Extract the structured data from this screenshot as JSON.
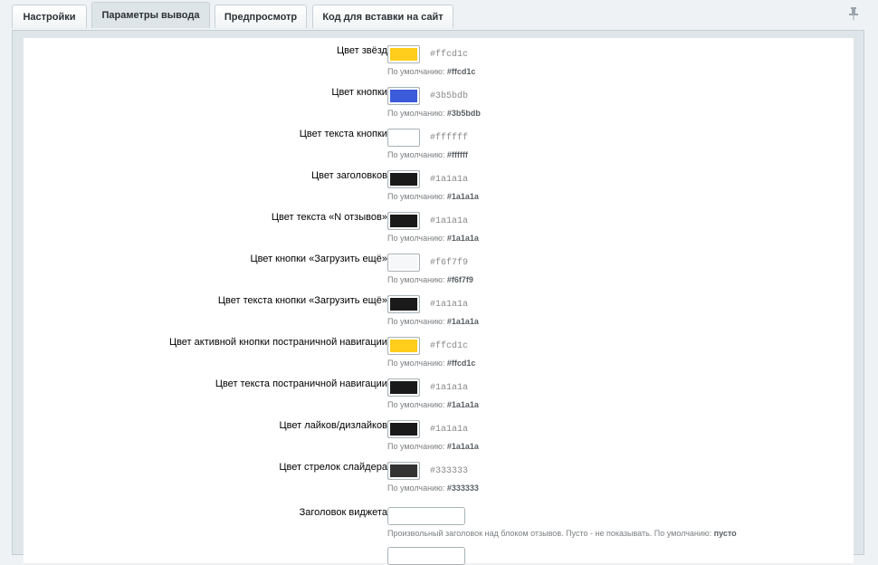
{
  "tabs": [
    {
      "label": "Настройки"
    },
    {
      "label": "Параметры вывода"
    },
    {
      "label": "Предпросмотр"
    },
    {
      "label": "Код для вставки на сайт"
    }
  ],
  "default_prefix": "По умолчанию:",
  "color_rows": [
    {
      "label": "Цвет звёзд:",
      "value": "#ffcd1c",
      "default": "#ffcd1c",
      "color": "#ffcd1c"
    },
    {
      "label": "Цвет кнопки:",
      "value": "#3b5bdb",
      "default": "#3b5bdb",
      "color": "#3b5bdb"
    },
    {
      "label": "Цвет текста кнопки:",
      "value": "#ffffff",
      "default": "#ffffff",
      "color": "#ffffff"
    },
    {
      "label": "Цвет заголовков:",
      "value": "#1a1a1a",
      "default": "#1a1a1a",
      "color": "#1a1a1a"
    },
    {
      "label": "Цвет текста «N отзывов»:",
      "value": "#1a1a1a",
      "default": "#1a1a1a",
      "color": "#1a1a1a"
    },
    {
      "label": "Цвет кнопки «Загрузить ещё»:",
      "value": "#f6f7f9",
      "default": "#f6f7f9",
      "color": "#f6f7f9"
    },
    {
      "label": "Цвет текста кнопки «Загрузить ещё»:",
      "value": "#1a1a1a",
      "default": "#1a1a1a",
      "color": "#1a1a1a"
    },
    {
      "label": "Цвет активной кнопки постраничной навигации:",
      "value": "#ffcd1c",
      "default": "#ffcd1c",
      "color": "#ffcd1c"
    },
    {
      "label": "Цвет текста постраничной навигации:",
      "value": "#1a1a1a",
      "default": "#1a1a1a",
      "color": "#1a1a1a"
    },
    {
      "label": "Цвет лайков/дизлайков:",
      "value": "#1a1a1a",
      "default": "#1a1a1a",
      "color": "#1a1a1a"
    },
    {
      "label": "Цвет стрелок слайдера:",
      "value": "#333333",
      "default": "#333333",
      "color": "#333333"
    }
  ],
  "widget_title": {
    "label": "Заголовок виджета:",
    "value": "",
    "hint": "Произвольный заголовок над блоком отзывов. Пусто - не показывать. По умолчанию:",
    "hint_default": "пусто"
  }
}
